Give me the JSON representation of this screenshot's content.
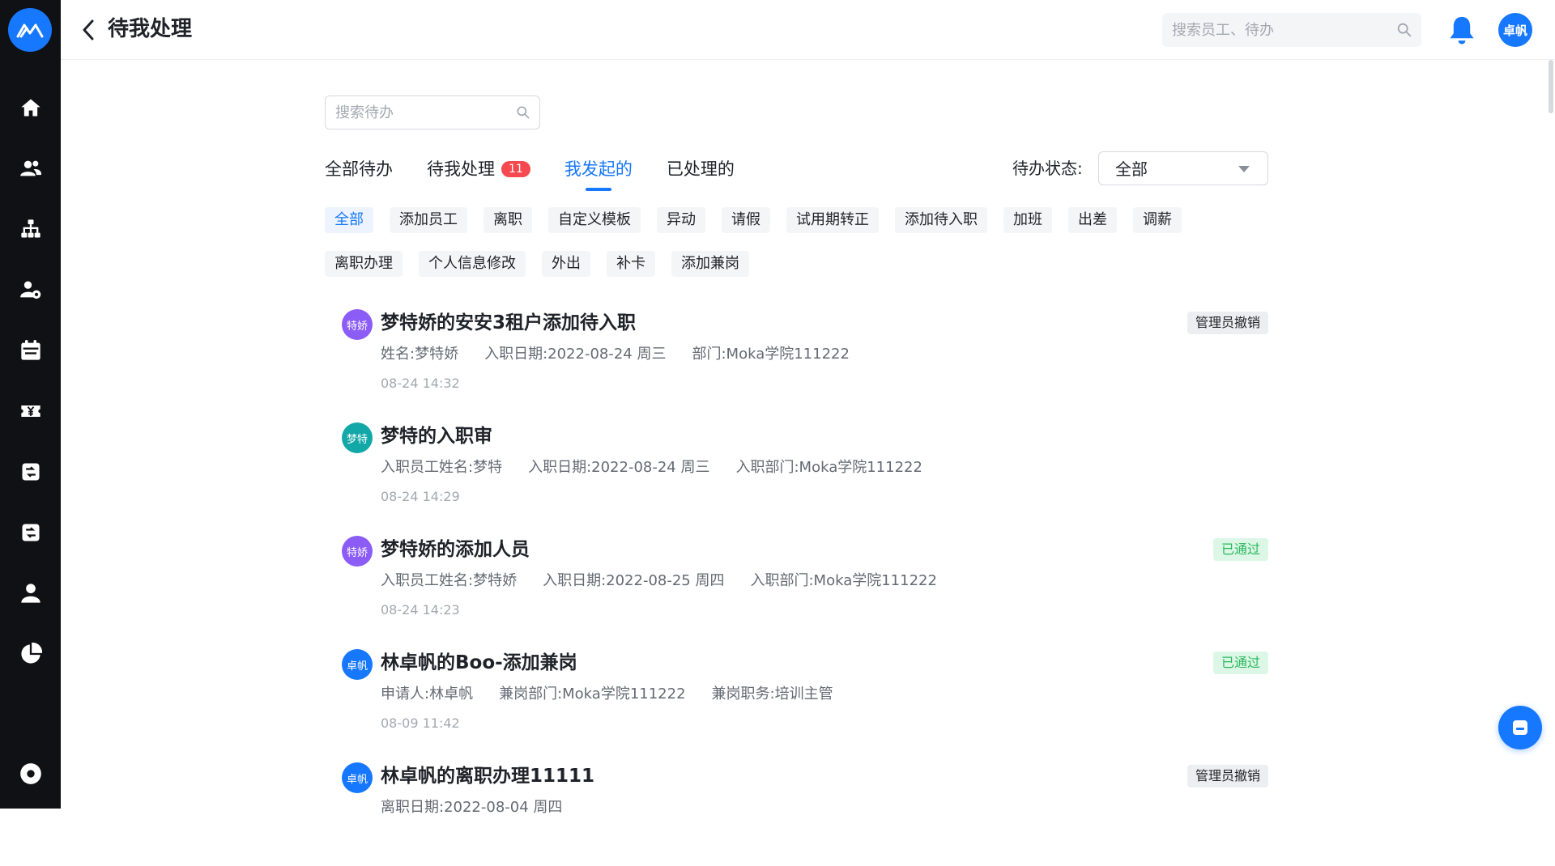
{
  "header": {
    "title": "待我处理",
    "global_search_placeholder": "搜索员工、待办",
    "user_avatar": "卓帆"
  },
  "sidebar": {
    "items": [
      {
        "icon": "home-icon"
      },
      {
        "icon": "people-icon"
      },
      {
        "icon": "org-chart-icon"
      },
      {
        "icon": "user-settings-icon"
      },
      {
        "icon": "calendar-icon"
      },
      {
        "icon": "salary-icon"
      },
      {
        "icon": "report-icon"
      },
      {
        "icon": "report-alt-icon"
      },
      {
        "icon": "person-icon"
      },
      {
        "icon": "pie-chart-icon"
      }
    ],
    "bottom_icon": "settings-icon"
  },
  "main": {
    "search_placeholder": "搜索待办",
    "tabs": [
      {
        "label": "全部待办",
        "active": false
      },
      {
        "label": "待我处理",
        "badge": "11",
        "active": false
      },
      {
        "label": "我发起的",
        "active": true
      },
      {
        "label": "已处理的",
        "active": false
      }
    ],
    "status_label": "待办状态:",
    "status_value": "全部",
    "chips": [
      "全部",
      "添加员工",
      "离职",
      "自定义模板",
      "异动",
      "请假",
      "试用期转正",
      "添加待入职",
      "加班",
      "出差",
      "调薪",
      "离职办理",
      "个人信息修改",
      "外出",
      "补卡",
      "添加兼岗"
    ],
    "active_chip": 0,
    "items": [
      {
        "avatar": "特娇",
        "avatar_color": "#8b5cf6",
        "title": "梦特娇的安安3租户添加待入职",
        "fields": [
          "姓名:梦特娇",
          "入职日期:2022-08-24 周三",
          "部门:Moka学院111222"
        ],
        "time": "08-24 14:32",
        "tag": "管理员撤销",
        "tag_type": "gray"
      },
      {
        "avatar": "梦特",
        "avatar_color": "#13a8a8",
        "title": "梦特的入职审",
        "fields": [
          "入职员工姓名:梦特",
          "入职日期:2022-08-24 周三",
          "入职部门:Moka学院111222"
        ],
        "time": "08-24 14:29",
        "tag": "",
        "tag_type": ""
      },
      {
        "avatar": "特娇",
        "avatar_color": "#8b5cf6",
        "title": "梦特娇的添加人员",
        "fields": [
          "入职员工姓名:梦特娇",
          "入职日期:2022-08-25 周四",
          "入职部门:Moka学院111222"
        ],
        "time": "08-24 14:23",
        "tag": "已通过",
        "tag_type": "green"
      },
      {
        "avatar": "卓帆",
        "avatar_color": "#1677ff",
        "title": "林卓帆的Boo-添加兼岗",
        "fields": [
          "申请人:林卓帆",
          "兼岗部门:Moka学院111222",
          "兼岗职务:培训主管"
        ],
        "time": "08-09 11:42",
        "tag": "已通过",
        "tag_type": "green"
      },
      {
        "avatar": "卓帆",
        "avatar_color": "#1677ff",
        "title": "林卓帆的离职办理11111",
        "fields": [
          "离职日期:2022-08-04 周四"
        ],
        "time": "",
        "tag": "管理员撤销",
        "tag_type": "gray"
      }
    ]
  },
  "colors": {
    "accent": "#1677ff",
    "badge": "#f5484f",
    "rail": "#101114",
    "success": "#27b85c"
  }
}
